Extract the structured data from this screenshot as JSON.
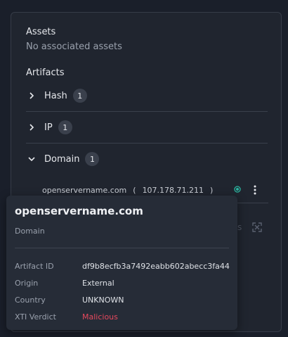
{
  "assets": {
    "title": "Assets",
    "empty_text": "No associated assets"
  },
  "artifacts": {
    "title": "Artifacts",
    "groups": [
      {
        "label": "Hash",
        "count": "1",
        "expanded": false
      },
      {
        "label": "IP",
        "count": "1",
        "expanded": false
      },
      {
        "label": "Domain",
        "count": "1",
        "expanded": true
      }
    ],
    "domain_item": {
      "name": "openservername.com",
      "open_paren": "(",
      "ip": "107.178.71.211",
      "close_paren": ")",
      "status_color": "#2bb5a0"
    },
    "hidden_text": "s"
  },
  "tooltip": {
    "title": "openservername.com",
    "type": "Domain",
    "fields": [
      {
        "key": "Artifact ID",
        "value": "df9b8ecfb3a7492eabb602abecc3fa44"
      },
      {
        "key": "Origin",
        "value": "External"
      },
      {
        "key": "Country",
        "value": "UNKNOWN"
      },
      {
        "key": "XTI Verdict",
        "value": "Malicious"
      }
    ],
    "verdict_color": "#e5485d"
  },
  "icons": {
    "collapsed": "chevron-right-icon",
    "expanded": "chevron-down-icon",
    "more": "more-vertical-icon",
    "expand": "expand-icon",
    "status": "status-dot-icon"
  }
}
